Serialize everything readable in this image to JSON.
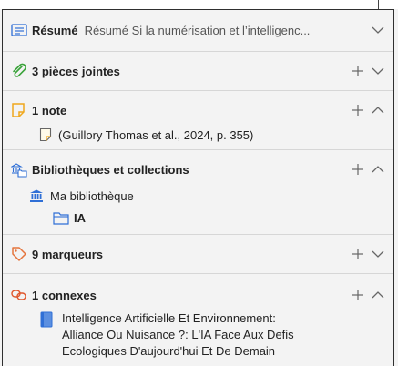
{
  "abstract": {
    "title": "Résumé",
    "preview": "Résumé Si la numérisation et l’intelligenc..."
  },
  "attachments": {
    "title": "3 pièces jointes"
  },
  "notes": {
    "title": "1 note",
    "items": [
      {
        "label": "(Guillory Thomas et al., 2024, p. 355)"
      }
    ]
  },
  "libraries": {
    "title": "Bibliothèques et collections",
    "library": "Ma bibliothèque",
    "collection": "IA"
  },
  "tags": {
    "title": "9 marqueurs"
  },
  "related": {
    "title": "1 connexes",
    "items": [
      {
        "line1": "Intelligence Artificielle Et Environnement:",
        "line2": "Alliance Ou Nuisance ?: L'IA Face Aux Defis",
        "line3": "Ecologiques D'aujourd'hui Et De Demain"
      }
    ]
  },
  "colors": {
    "abstract_icon": "#2f6fd6",
    "attachment_icon": "#3aa33a",
    "note_icon": "#f0a81c",
    "library_icon": "#2f6fd6",
    "tag_icon": "#e5743c",
    "related_icon": "#e0572d",
    "control": "#666666"
  },
  "icons": {
    "abstract": "document-lines-icon",
    "attachments": "paperclip-icon",
    "note": "sticky-note-icon",
    "libraries": "library-collection-icon",
    "library": "institution-icon",
    "collection": "folder-icon",
    "tags": "tag-icon",
    "related": "link-icon",
    "related_item": "book-icon",
    "add": "plus-icon",
    "expand": "chevron-down-icon",
    "collapse": "chevron-up-icon"
  }
}
